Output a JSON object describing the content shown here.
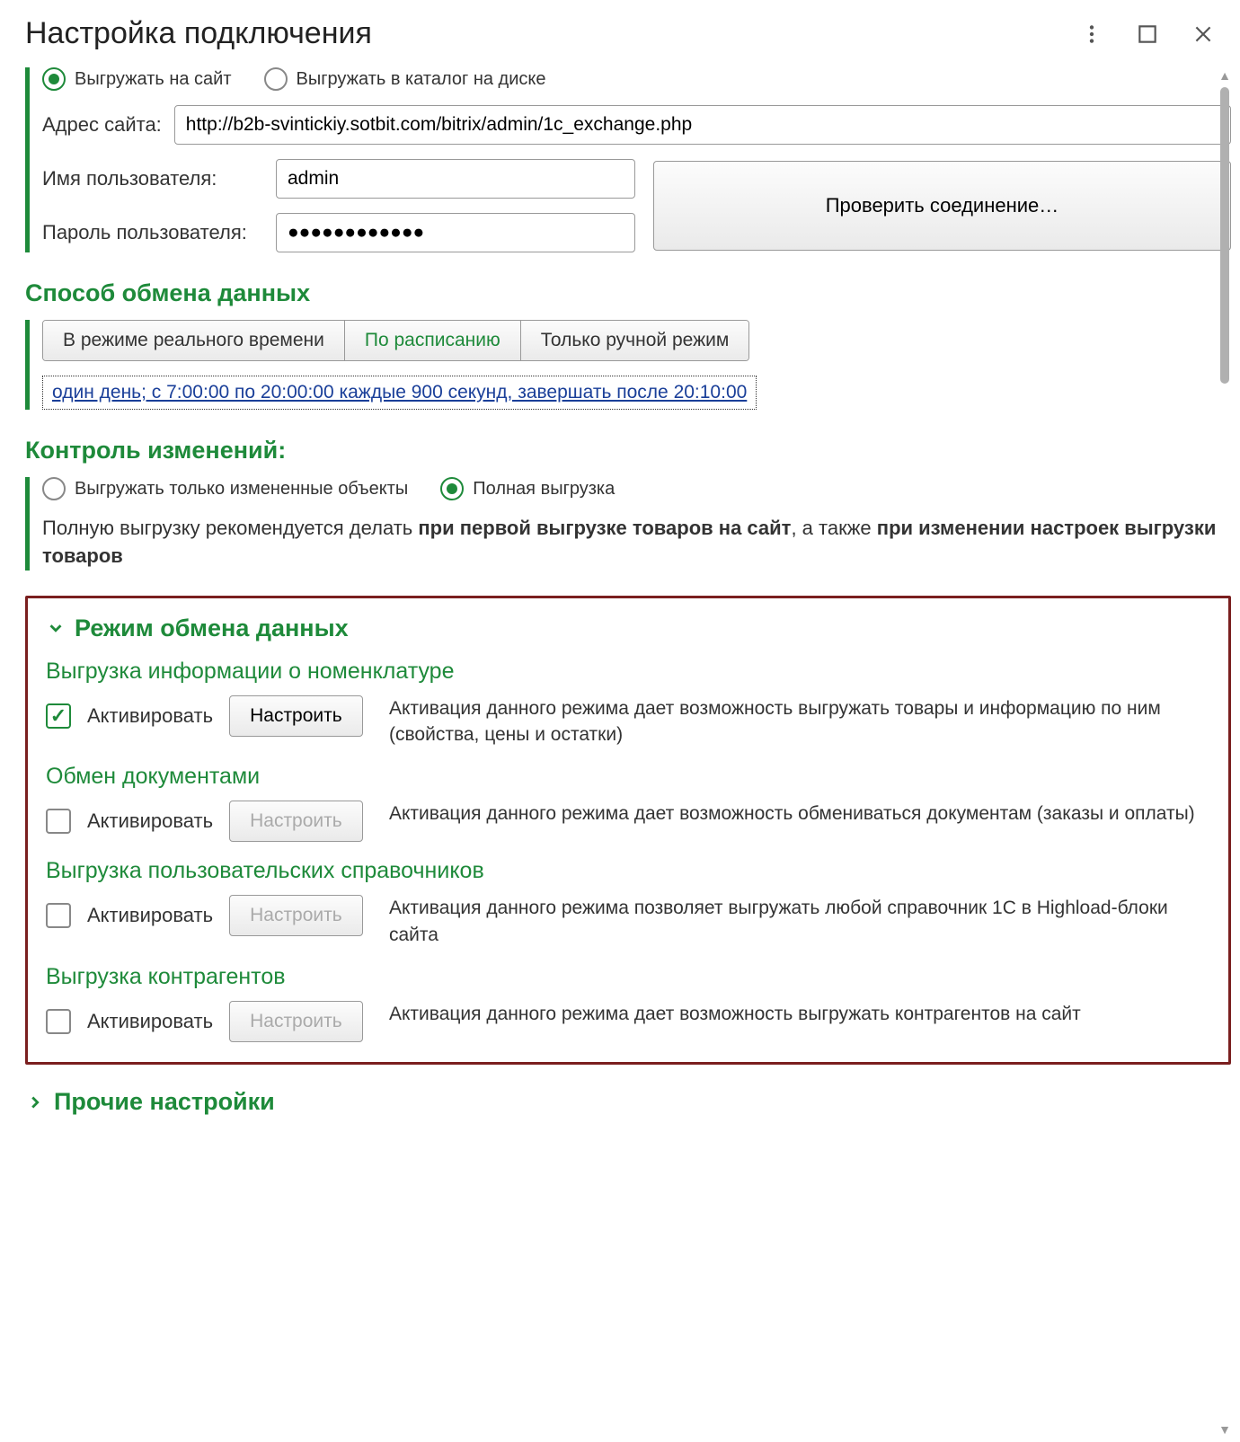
{
  "window": {
    "title": "Настройка подключения"
  },
  "upload_target": {
    "to_site": "Выгружать на сайт",
    "to_disk": "Выгружать в каталог на диске",
    "selected": "site"
  },
  "site": {
    "label": "Адрес сайта:",
    "value": "http://b2b-svintickiy.sotbit.com/bitrix/admin/1c_exchange.php"
  },
  "user": {
    "label": "Имя пользователя:",
    "value": "admin"
  },
  "password": {
    "label": "Пароль пользователя:",
    "value": "●●●●●●●●●●●●"
  },
  "test_connection": "Проверить соединение…",
  "exchange_method": {
    "title": "Способ обмена  данных",
    "options": [
      "В режиме реального времени",
      "По расписанию",
      "Только ручной режим"
    ],
    "selected_index": 1,
    "schedule_text": "один день; с 7:00:00 по 20:00:00 каждые 900 секунд, завершать после 20:10:00"
  },
  "change_control": {
    "title": "Контроль изменений:",
    "only_changed": "Выгружать только измененные объекты",
    "full": "Полная выгрузка",
    "selected": "full",
    "note_pre": "Полную выгрузку рекомендуется делать ",
    "note_b1": "при первой выгрузке товаров на сайт",
    "note_mid": ", а также ",
    "note_b2": "при изменении настроек выгрузки товаров"
  },
  "modes": {
    "header": "Режим обмена данных",
    "activate_label": "Активировать",
    "configure_label": "Настроить",
    "items": [
      {
        "title": "Выгрузка информации о номенклатуре",
        "active": true,
        "desc": "Активация данного режима дает возможность выгружать товары и информацию по ним (свойства, цены и остатки)"
      },
      {
        "title": "Обмен документами",
        "active": false,
        "desc": "Активация данного режима дает возможность обмениваться документам (заказы и оплаты)"
      },
      {
        "title": "Выгрузка пользовательских справочников",
        "active": false,
        "desc": "Активация данного режима позволяет выгружать любой справочник 1С в Highload-блоки сайта"
      },
      {
        "title": "Выгрузка контрагентов",
        "active": false,
        "desc": "Активация данного режима дает возможность выгружать контрагентов на сайт"
      }
    ]
  },
  "other_settings": "Прочие настройки"
}
